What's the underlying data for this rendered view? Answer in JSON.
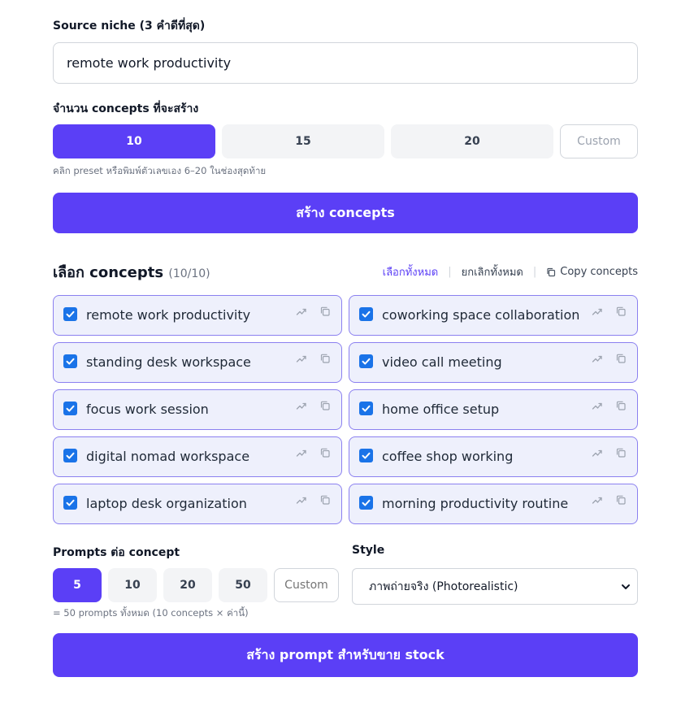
{
  "source_niche": {
    "label": "Source niche (3 คำดีที่สุด)",
    "value": "remote work productivity"
  },
  "concept_count": {
    "label": "จำนวน concepts ที่จะสร้าง",
    "presets": [
      "10",
      "15",
      "20"
    ],
    "selected": "10",
    "custom_placeholder": "Custom",
    "hint": "คลิก preset หรือพิมพ์ตัวเลขเอง 6–20 ในช่องสุดท้าย"
  },
  "generate_concepts_label": "สร้าง concepts",
  "select_concepts": {
    "title": "เลือก concepts",
    "count": "(10/10)",
    "select_all": "เลือกทั้งหมด",
    "deselect_all": "ยกเลิกทั้งหมด",
    "copy": "Copy concepts"
  },
  "concepts": [
    {
      "label": "remote work productivity",
      "checked": true
    },
    {
      "label": "coworking space collaboration",
      "checked": true
    },
    {
      "label": "standing desk workspace",
      "checked": true
    },
    {
      "label": "video call meeting",
      "checked": true
    },
    {
      "label": "focus work session",
      "checked": true
    },
    {
      "label": "home office setup",
      "checked": true
    },
    {
      "label": "digital nomad workspace",
      "checked": true
    },
    {
      "label": "coffee shop working",
      "checked": true
    },
    {
      "label": "laptop desk organization",
      "checked": true
    },
    {
      "label": "morning productivity routine",
      "checked": true
    }
  ],
  "prompts_per_concept": {
    "label": "Prompts ต่อ concept",
    "presets": [
      "5",
      "10",
      "20",
      "50"
    ],
    "selected": "5",
    "custom_placeholder": "Custom",
    "hint": "= 50 prompts ทั้งหมด (10 concepts × ค่านี้)"
  },
  "style": {
    "label": "Style",
    "selected": "ภาพถ่ายจริง (Photorealistic)"
  },
  "generate_prompts_label": "สร้าง prompt สำหรับขาย stock",
  "colors": {
    "accent": "#5b3ff6",
    "card_bg": "#eef0fc",
    "card_border": "#8b80f0",
    "checkbox": "#1a73e8"
  },
  "icons": {
    "card_trend": "trending-up-icon",
    "card_copy": "copy-icon",
    "header_copy": "copy-icon",
    "select_chevron": "chevron-down-icon"
  }
}
